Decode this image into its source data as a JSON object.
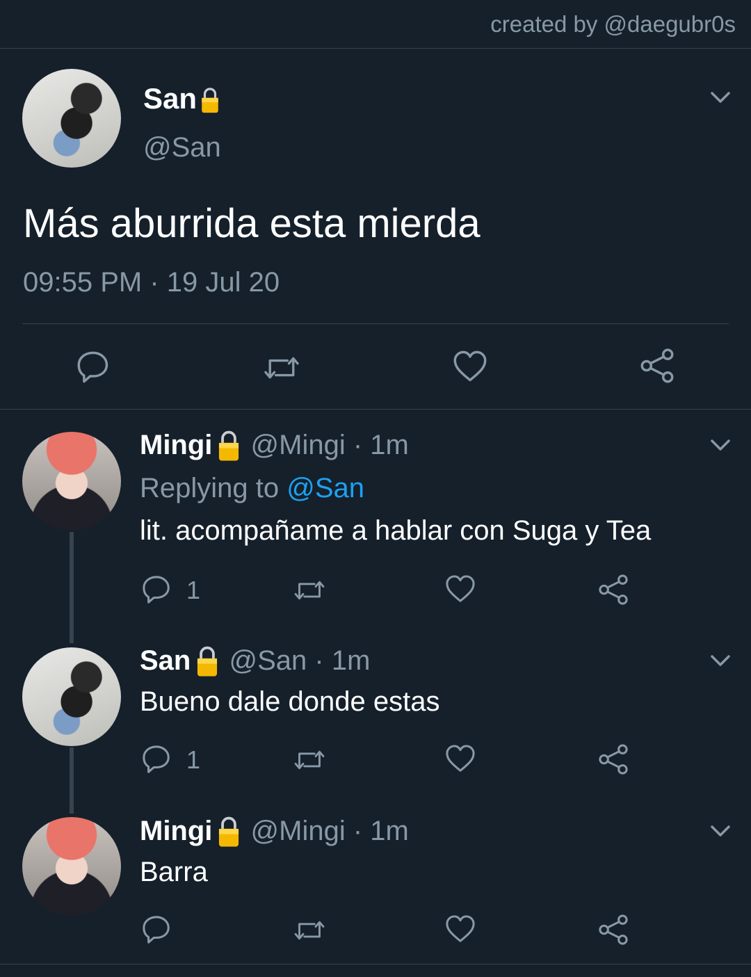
{
  "credit": "created by @daegubr0s",
  "main_tweet": {
    "display_name": "San",
    "handle": "@San",
    "text": "Más aburrida esta mierda",
    "timestamp": "09:55 PM · 19 Jul 20"
  },
  "replies": [
    {
      "display_name": "Mingi",
      "handle": "@Mingi",
      "time": "· 1m",
      "replying_prefix": "Replying to ",
      "replying_to": "@San",
      "text": "lit. acompañame a hablar con Suga y Tea",
      "reply_count": "1"
    },
    {
      "display_name": "San",
      "handle": "@San",
      "time": "· 1m",
      "text": "Bueno dale donde estas",
      "reply_count": "1"
    },
    {
      "display_name": "Mingi",
      "handle": "@Mingi",
      "time": "· 1m",
      "text": "Barra",
      "reply_count": ""
    }
  ],
  "icons": {
    "lock": "lock-icon",
    "reply": "reply-icon",
    "retweet": "retweet-icon",
    "like": "heart-icon",
    "share": "share-icon",
    "menu": "chevron-down-icon"
  },
  "colors": {
    "background": "#15202b",
    "secondary_text": "#8899a6",
    "link": "#1da1f2",
    "divider": "#38444d",
    "lock": "#f5b800"
  }
}
